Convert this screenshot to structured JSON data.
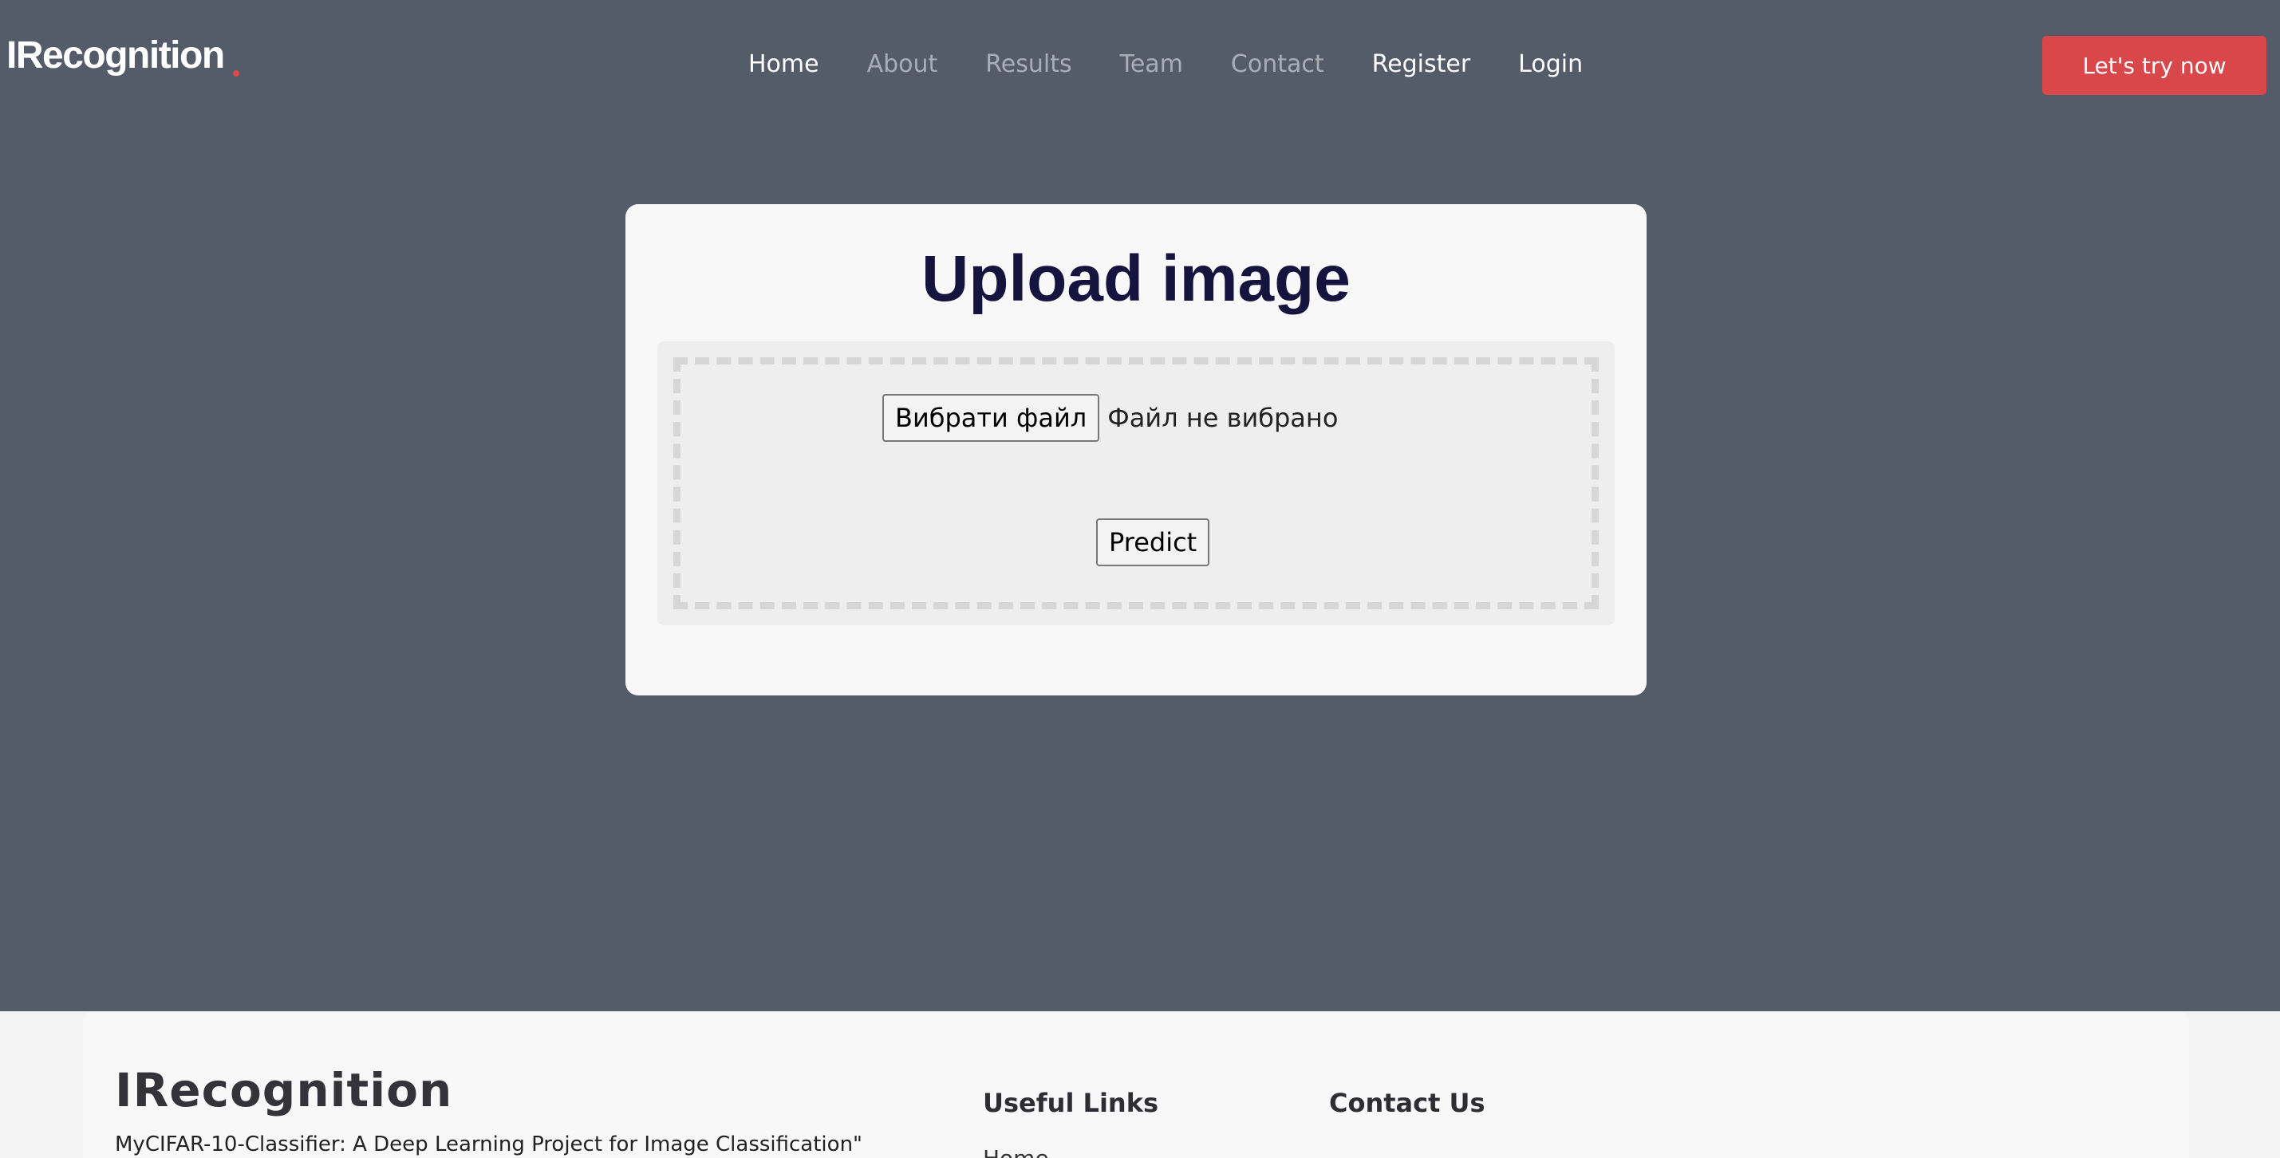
{
  "header": {
    "logo_text": "IRecognition",
    "nav": [
      {
        "label": "Home",
        "state": "active"
      },
      {
        "label": "About",
        "state": "dim"
      },
      {
        "label": "Results",
        "state": "dim"
      },
      {
        "label": "Team",
        "state": "dim"
      },
      {
        "label": "Contact",
        "state": "dim"
      },
      {
        "label": "Register",
        "state": "active"
      },
      {
        "label": "Login",
        "state": "active"
      }
    ],
    "cta_label": "Let's try now"
  },
  "upload": {
    "title": "Upload image",
    "choose_file_label": "Вибрати файл",
    "file_status": "Файл не вибрано",
    "predict_label": "Predict"
  },
  "footer": {
    "brand": "IRecognition",
    "description": "MyCIFAR-10-Classifier: A Deep Learning Project for Image Classification\"",
    "useful_links_heading": "Useful Links",
    "contact_heading": "Contact Us",
    "first_link": "Home"
  },
  "colors": {
    "background": "#555c69",
    "accent": "#d9474a",
    "title": "#16133f"
  }
}
